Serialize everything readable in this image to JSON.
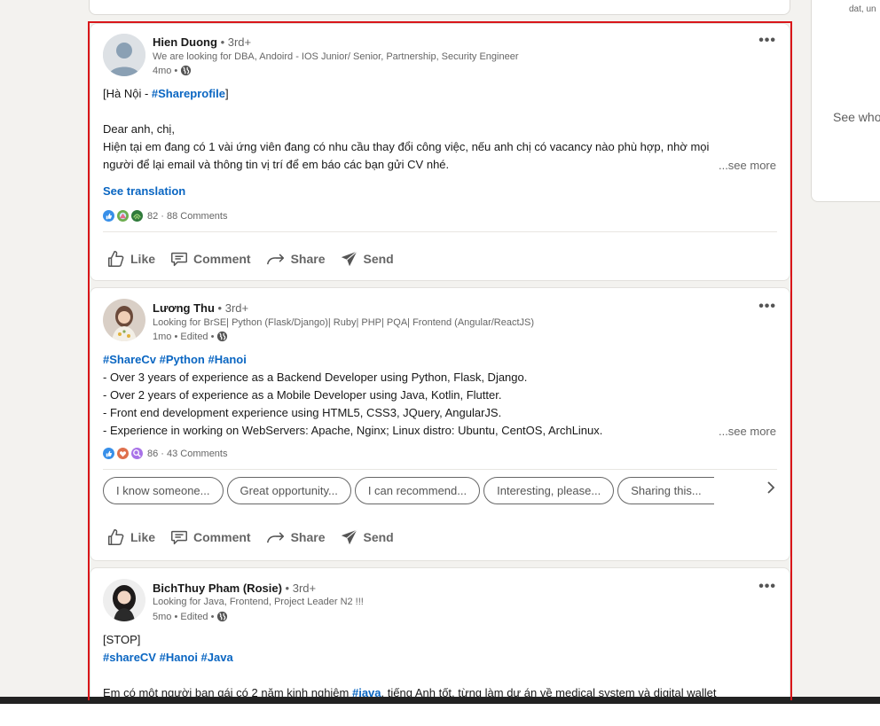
{
  "right_panel": {
    "small_text": "dat, un",
    "main_text": "See who"
  },
  "posts": [
    {
      "author": "Hien Duong",
      "degree": "3rd+",
      "headline": "We are looking for DBA, Andoird - IOS Junior/ Senior, Partnership, Security Engineer",
      "time": "4mo",
      "body": {
        "loc_prefix": "[Hà Nội - ",
        "loc_tag": "#Shareprofile",
        "loc_suffix": "]",
        "line2": "Dear anh, chị,",
        "line3": "Hiện tại em đang có 1 vài ứng viên đang có nhu cầu thay đổi công việc, nếu anh chị có vacancy nào phù hợp, nhờ mọi",
        "line4": "người để lại email và thông tin vị trí để em báo các bạn gửi CV nhé."
      },
      "see_more": "...see more",
      "see_translation": "See translation",
      "reactions": "82 · 88 Comments"
    },
    {
      "author": "Lương Thu",
      "degree": "3rd+",
      "headline": "Looking for BrSE| Python (Flask/Django)| Ruby| PHP| PQA| Frontend (Angular/ReactJS)",
      "time": "1mo • Edited",
      "body": {
        "tags": "#ShareCv #Python #Hanoi",
        "line1": "- Over 3 years of experience as a Backend Developer using Python, Flask, Django.",
        "line2": "- Over 2 years of experience as a Mobile Developer using Java, Kotlin, Flutter.",
        "line3": "- Front end development experience using HTML5, CSS3, JQuery, AngularJS.",
        "line4": "- Experience in working on WebServers: Apache, Nginx; Linux distro: Ubuntu, CentOS, ArchLinux."
      },
      "see_more": "...see more",
      "reactions": "86 · 43 Comments",
      "suggestions": [
        "I know someone...",
        "Great opportunity...",
        "I can recommend...",
        "Interesting, please...",
        "Sharing this..."
      ]
    },
    {
      "author": "BichThuy Pham (Rosie)",
      "degree": "3rd+",
      "headline": "Looking for Java, Frontend, Project Leader N2 !!!",
      "time": "5mo • Edited",
      "body": {
        "line1": "[STOP]",
        "tags": "#shareCV #Hanoi #Java",
        "line3_prefix": "Em có một người bạn gái có 2 năm kinh nghiệm ",
        "line3_tag": "#java",
        "line3_suffix": ", tiếng Anh tốt, từng làm dự án về medical system và digital wallet"
      }
    }
  ],
  "actions": {
    "like": "Like",
    "comment": "Comment",
    "share": "Share",
    "send": "Send"
  },
  "more_dots": "•••",
  "separator": "•",
  "colors": {
    "link": "#0a66c2",
    "highlight": "#d9161a",
    "bg": "#f3f2ef"
  }
}
